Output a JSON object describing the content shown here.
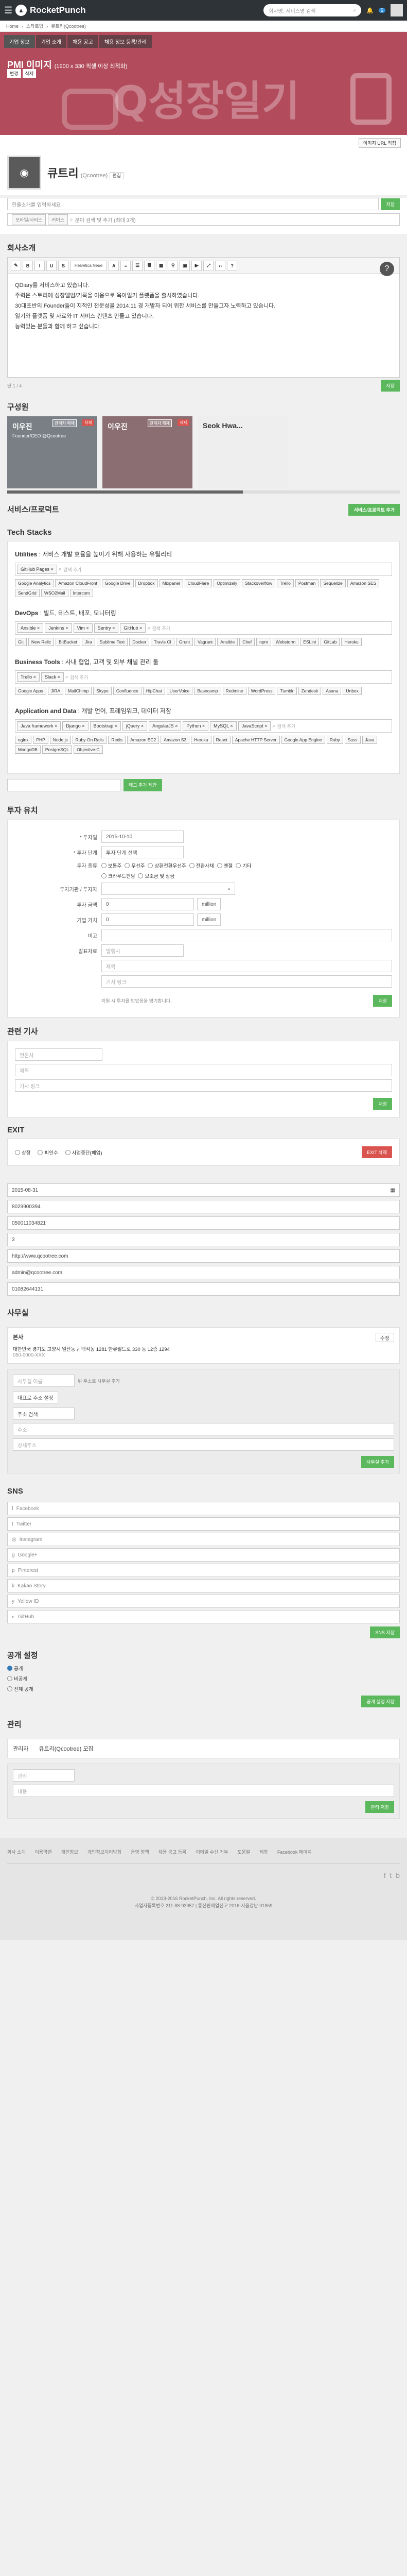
{
  "topbar": {
    "brand": "RocketPunch",
    "search_placeholder": "회사명, 서비스명 검색",
    "notif_count": "5"
  },
  "breadcrumb": [
    "Home",
    "스타트업",
    "큐트리(Qcootree)"
  ],
  "cover": {
    "tabs": [
      "기업 정보",
      "기업 소개",
      "채용 공고",
      "채용 정보 등록/관리"
    ],
    "title": "PMI 이미지",
    "title_sub": "(1900 x 330 픽셀 이상 최적화)",
    "edit_buttons": [
      "변경",
      "삭제"
    ],
    "bg_text": "Q성장일기",
    "note": "이미지 URL 직접"
  },
  "profile": {
    "name": "큐트리",
    "name_en": "(Qcootree)",
    "edit_label": "편집",
    "tagline_placeholder": "한줄소개를 입력하세요",
    "tagline_save": "저장",
    "category_chips": [
      "모바일/서비스",
      "커머스"
    ],
    "category_placeholder": "분야 검색 및 추가 (최대 3개)"
  },
  "intro": {
    "title": "회사소개",
    "font_name": "Helvetica Neue",
    "text_lines": [
      "QDiary를 서비스하고 있습니다.",
      "주력은 스토리에 성장앨범/기록을 이용으로 육아일기 플랫폼을 출시하였습니다.",
      "30대초반의 Founder들이 지적인 전문성을 2014.11 경 개발자 되어 위한 서비스를 만들고자 노력하고 있습니다.",
      "일기와 플랫폼 및 자료와 IT 서비스 컨텐츠 만들고 있습니다.",
      "능력있는 분들과 함께 하고 싶습니다."
    ],
    "counter": "단 1 / 4",
    "save": "저장"
  },
  "members": {
    "title": "구성원",
    "items": [
      {
        "name": "이우진",
        "role": "Founder/CEO\n@Qcootree",
        "tag": "관리자 해제",
        "del": "삭제"
      },
      {
        "name": "이우진",
        "role": "",
        "tag": "관리자 해제",
        "del": "삭제"
      },
      {
        "name": "Seok Hwa...",
        "role": "",
        "tag": "",
        "del": ""
      }
    ]
  },
  "service": {
    "title": "서비스/프로덕트",
    "add": "서비스/프로덕트 추가"
  },
  "tech": {
    "title": "Tech Stacks",
    "groups": [
      {
        "title": "Utilities",
        "desc": " : 서비스 개발 효율을 높이기 위해 사용하는 유틸리티",
        "selected": [
          "GitHub Pages ×"
        ],
        "placeholder": "검색 추가",
        "options": [
          "Google Analytics",
          "Amazon CloudFront",
          "Google Drive",
          "Dropbox",
          "Mixpanel",
          "CloudFlare",
          "Optimizely",
          "Stackoverflow",
          "Trello",
          "Postman",
          "Sequelize",
          "Amazon SES",
          "SendGrid",
          "WSO2Mail",
          "Intercom"
        ]
      },
      {
        "title": "DevOps",
        "desc": " : 빌드, 테스트, 배포, 모니터링",
        "selected": [
          "Ansible ×",
          "Jenkins ×",
          "Vim ×",
          "Sentry ×",
          "GitHub ×"
        ],
        "placeholder": "검색 추가",
        "options": [
          "Git",
          "New Relic",
          "BitBucket",
          "Jira",
          "Sublime Text",
          "Docker",
          "Travis CI",
          "Grunt",
          "Vagrant",
          "Ansible",
          "Chef",
          "npm",
          "Webstorm",
          "ESLint",
          "GitLab",
          "Heroku"
        ]
      },
      {
        "title": "Business Tools",
        "desc": " : 사내 협업, 고객 및 외부 채널 관리 툴",
        "selected": [
          "Trello ×",
          "Slack ×"
        ],
        "placeholder": "검색 추가",
        "options": [
          "Google Apps",
          "JIRA",
          "MailChimp",
          "Skype",
          "Confluence",
          "HipChat",
          "UserVoice",
          "Basecamp",
          "Redmine",
          "WordPress",
          "Tumblr",
          "Zendesk",
          "Asana",
          "Unbox"
        ]
      },
      {
        "title": "Application and Data",
        "desc": " : 개발 언어, 프레임워크, 데이터 저장",
        "selected": [
          "Java framework ×",
          "Django ×",
          "Bootstrap ×",
          "jQuery ×",
          "AngularJS ×",
          "Python ×",
          "MySQL ×",
          "JavaScript ×"
        ],
        "placeholder": "검색 추가",
        "options": [
          "nginx",
          "PHP",
          "Node.js",
          "Ruby On Rails",
          "Redis",
          "Amazon EC2",
          "Amazon S3",
          "Heroku",
          "React",
          "Apache HTTP Server",
          "Google App Engine",
          "Ruby",
          "Sass",
          "Java",
          "MongoDB",
          "PostgreSQL",
          "Objective-C"
        ]
      }
    ],
    "new_tag_placeholder": "",
    "new_tag_button": "태그 추가 제안"
  },
  "invest": {
    "title": "투자 유치",
    "fields": {
      "date_label": "* 투자일",
      "date_value": "2015-10-10",
      "stage_label": "* 투자 단계",
      "stage_value": "투자 단계 선택",
      "type_label": "투자 종류",
      "types": [
        "보통주",
        "우선주",
        "상환전환우선주",
        "전환사채",
        "엔젤",
        "기타"
      ],
      "types2": [
        "크라우드펀딩",
        "보조금 및 상금"
      ],
      "investor_label": "투자기관 / 투자자",
      "amount_label": "투자 금액",
      "amount_unit": "million",
      "valuation_label": "기업 가치",
      "memo_label": "비고",
      "link_label": "발표자료",
      "link_ph1": "발행시",
      "link_ph2": "제목",
      "link_ph3": "기사 링크"
    },
    "note": "지원 시 투자를 받았음을 명기합니다.",
    "save": "저장"
  },
  "news": {
    "title": "관련 기사",
    "ph1": "언론사",
    "ph2": "제목",
    "ph3": "기사 링크",
    "save": "저장"
  },
  "exit": {
    "title": "EXIT",
    "options": [
      "상장",
      "피인수",
      "사업중단(폐업)"
    ],
    "delete": "EXIT 삭제"
  },
  "info": {
    "founded": "2015-08-31",
    "biz_no": "8029900394",
    "phone": "050011034821",
    "employees": "3",
    "homepage": "http://www.qcootree.com",
    "email": "admin@qcootree.com",
    "fax": "01082644131"
  },
  "office": {
    "title": "사무실",
    "edit": "수정",
    "label": "본사",
    "address": "대한민국 경기도 고양시 일산동구 백석동 1281 한류월드로 330 동 12층 1294",
    "phone": "050-0000-XXX",
    "add_placeholder": "사무실 이름",
    "add_hint": "위 주소로 사무실 추가",
    "main_check": "대표로 주소 설정",
    "addr_head": "주소 검색",
    "addr_ph1": "주소",
    "addr_ph2": "상세주소",
    "save": "사무실 추가"
  },
  "sns": {
    "title": "SNS",
    "items": [
      "Facebook",
      "Twitter",
      "Instagram",
      "Google+",
      "Pinterest",
      "Kakao Story",
      "Yellow ID",
      "GitHub"
    ],
    "save": "SNS 저장"
  },
  "visibility": {
    "title": "공개 설정",
    "options": [
      "공개",
      "비공개",
      "전체 공개"
    ],
    "save": "공개 설정 저장"
  },
  "admin": {
    "title": "관리",
    "label": "관리자",
    "value": "큐트리(Qcootree) 모집",
    "ph1": "관리",
    "ph2": "내용",
    "save": "관리 저장"
  },
  "footer": {
    "links": [
      "회사 소개",
      "이용약관",
      "개인정보",
      "개인정보처리방침",
      "운영 정책",
      "채용 공고 등록",
      "이메일 수신 거부",
      "도움말",
      "제휴",
      "Facebook 페이지"
    ],
    "copyright": "© 2013-2016 RocketPunch, Inc. All rights reserved.",
    "sub": "사업자등록번호 211-88-93957 | 통신판매업신고 2016-서울강남-01859"
  }
}
